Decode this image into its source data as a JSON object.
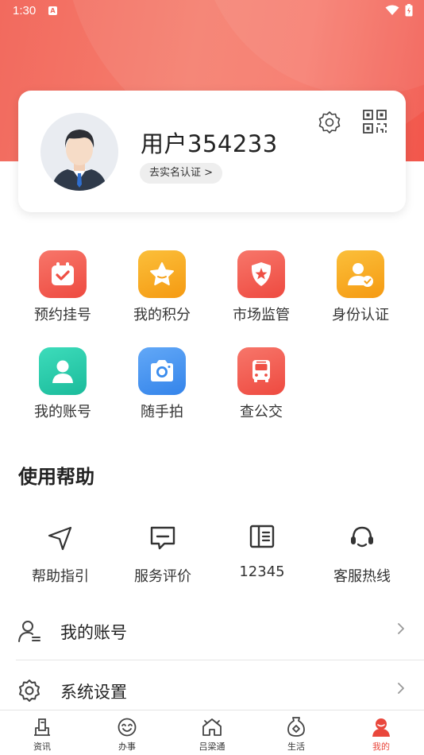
{
  "status_bar": {
    "time": "1:30",
    "notif_icon": "A"
  },
  "profile": {
    "username": "用户354233",
    "verify_label": "去实名认证 >",
    "settings_icon": "gear-icon",
    "qr_icon": "qr-code-icon"
  },
  "services": [
    {
      "label": "预约挂号",
      "icon": "calendar-check-icon",
      "color": "#f2564b"
    },
    {
      "label": "我的积分",
      "icon": "star-icon",
      "color": "#f7a21b"
    },
    {
      "label": "市场监管",
      "icon": "police-badge-icon",
      "color": "#f2564b"
    },
    {
      "label": "身份认证",
      "icon": "user-verified-icon",
      "color": "#f7a21b"
    },
    {
      "label": "我的账号",
      "icon": "user-icon",
      "color": "#26c6a6"
    },
    {
      "label": "随手拍",
      "icon": "camera-icon",
      "color": "#3f8ff0"
    },
    {
      "label": "查公交",
      "icon": "bus-icon",
      "color": "#f2564b"
    }
  ],
  "help": {
    "title": "使用帮助",
    "items": [
      {
        "label": "帮助指引",
        "icon": "navigation-arrow-icon"
      },
      {
        "label": "服务评价",
        "icon": "comment-icon"
      },
      {
        "label": "12345",
        "icon": "book-icon"
      },
      {
        "label": "客服热线",
        "icon": "headset-icon"
      }
    ]
  },
  "menu": [
    {
      "label": "我的账号",
      "icon": "user-list-icon"
    },
    {
      "label": "系统设置",
      "icon": "gear-icon"
    }
  ],
  "tabs": [
    {
      "label": "资讯",
      "icon": "news-icon",
      "active": false
    },
    {
      "label": "办事",
      "icon": "smile-icon",
      "active": false
    },
    {
      "label": "吕梁通",
      "icon": "home-icon",
      "active": false
    },
    {
      "label": "生活",
      "icon": "life-icon",
      "active": false
    },
    {
      "label": "我的",
      "icon": "profile-icon",
      "active": true
    }
  ],
  "colors": {
    "accent": "#f2564b",
    "active_tab": "#e9473c"
  }
}
